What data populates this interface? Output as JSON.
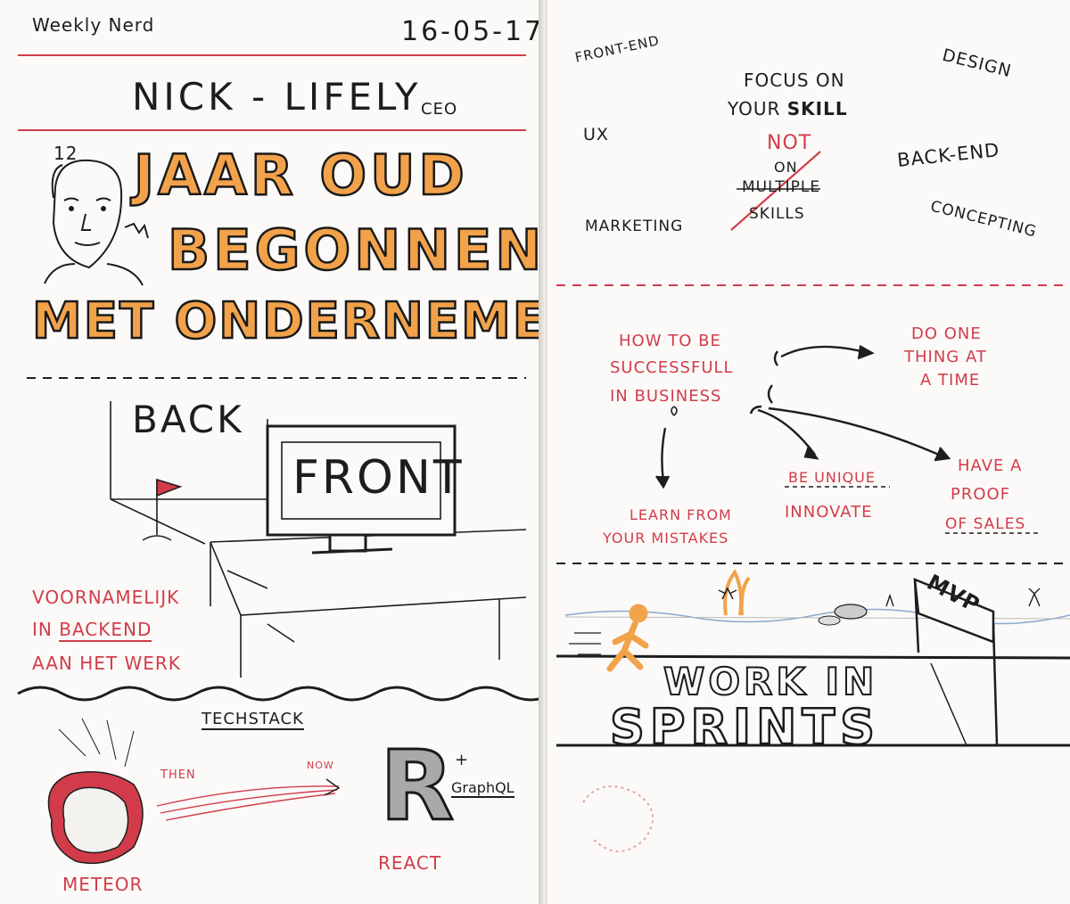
{
  "left": {
    "header_title": "Weekly Nerd",
    "header_date": "16-05-17",
    "speaker_name": "NICK - LIFELY",
    "speaker_role": "CEO",
    "age_number": "12",
    "headline_line1": "JAAR OUD",
    "headline_line2": "BEGONNEN",
    "headline_line3": "MET ONDERNEMEN",
    "back_label": "BACK",
    "front_label": "FRONT",
    "note_line1": "VOORNAMELIJK",
    "note_line2_prefix": "IN ",
    "note_line2_emph": "BACKEND",
    "note_line3": "AAN HET WERK",
    "techstack_label": "TECHSTACK",
    "then_label": "THEN",
    "now_label": "NOW",
    "react_letter": "R",
    "plus_sign": "+",
    "graphql_label": "GraphQL",
    "meteor_label": "METEOR",
    "react_label": "REACT"
  },
  "right": {
    "frontend_label": "FRONT-END",
    "focus_line1": "FOCUS ON",
    "focus_line2_prefix": "YOUR ",
    "focus_line2_emph": "SKILL",
    "design_label": "DESIGN",
    "ux_label": "UX",
    "not_label": "NOT",
    "on_label": "ON",
    "multiple_label": "MULTIPLE",
    "skills_label": "SKILLS",
    "backend_label": "BACK-END",
    "marketing_label": "MARKETING",
    "concepting_label": "CONCEPTING",
    "success_line1": "HOW TO BE",
    "success_line2": "SUCCESSFULL",
    "success_line3": "IN BUSINESS",
    "doone_line1": "DO ONE",
    "doone_line2": "THING AT",
    "doone_line3": "A TIME",
    "learn_line1": "LEARN FROM",
    "learn_line2": "YOUR MISTAKES",
    "unique_line1": "BE UNIQUE",
    "unique_line2": "INNOVATE",
    "proof_line1": "HAVE A",
    "proof_line2": "PROOF",
    "proof_line3": "OF SALES",
    "mvp_label": "MVP",
    "work_line1": "WORK IN",
    "work_line2": "SPRINTS"
  },
  "colors": {
    "ink": "#1d1d1d",
    "red": "#d23c4a",
    "orange": "#f2a24a",
    "paper": "#fbfaf8"
  }
}
